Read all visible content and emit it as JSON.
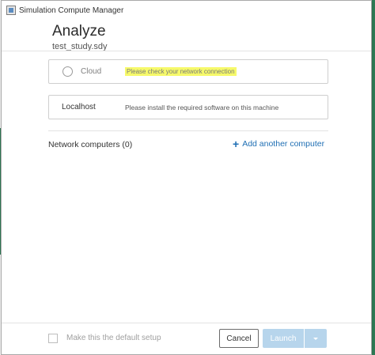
{
  "window": {
    "title": "Simulation Compute Manager",
    "icon": "app-icon"
  },
  "header": {
    "title": "Analyze",
    "subtitle": "test_study.sdy"
  },
  "options": {
    "cloud": {
      "label": "Cloud",
      "message": "Please check your network connection",
      "icon": "radio-unselected-icon",
      "highlight_color": "#f6f96a"
    },
    "localhost": {
      "label": "Localhost",
      "message": "Please install the required software on this machine"
    }
  },
  "network": {
    "label": "Network computers (0)",
    "add_label": "Add another computer",
    "add_icon": "plus-icon",
    "link_color": "#1f6fb4"
  },
  "footer": {
    "default_setup_label": "Make this the default setup",
    "cancel_label": "Cancel",
    "launch_label": "Launch",
    "launch_dropdown_icon": "chevron-down-icon",
    "launch_color": "#b7d5ec"
  },
  "colors": {
    "accent_green": "#2f7d57"
  }
}
